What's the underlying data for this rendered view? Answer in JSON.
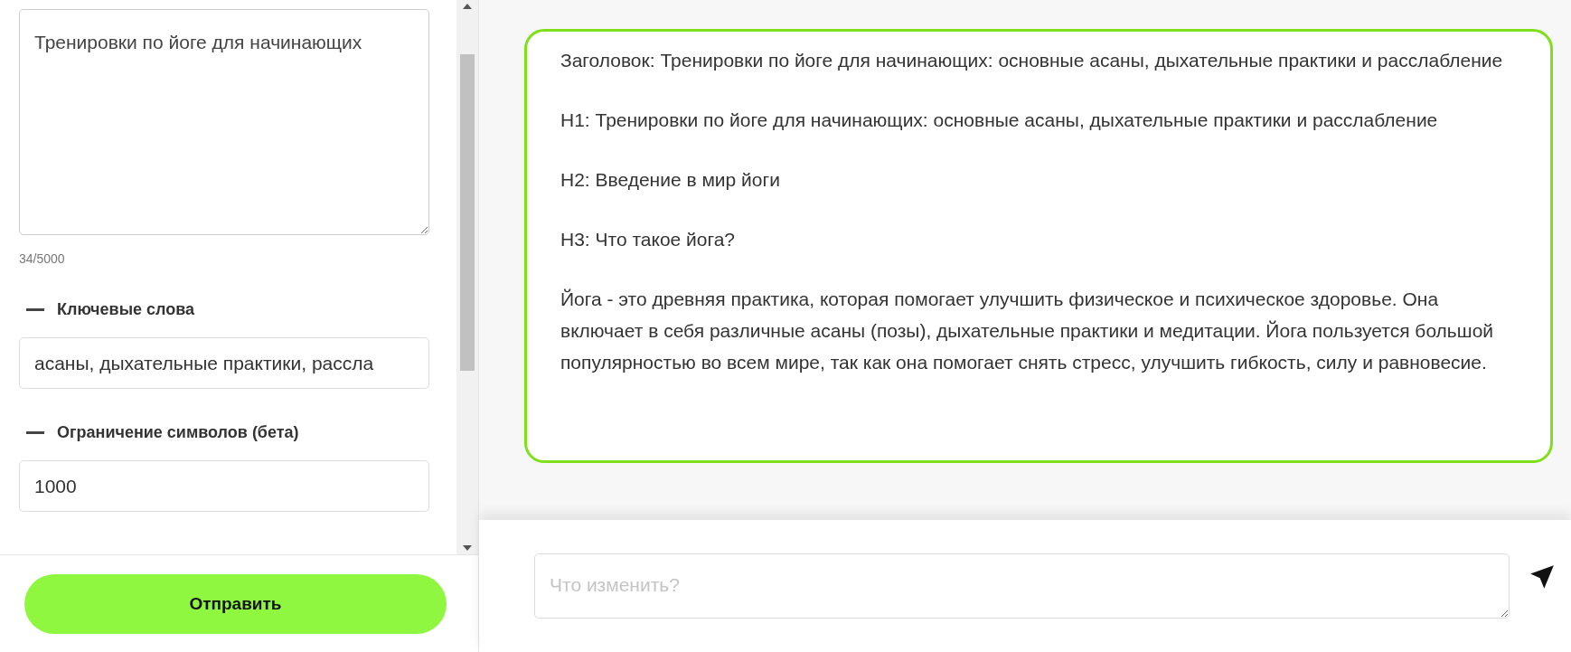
{
  "form": {
    "topic": {
      "value": "Тренировки по йоге для начинающих"
    },
    "counter": "34/5000",
    "fields": [
      {
        "label": "Ключевые слова",
        "value": "асаны, дыхательные практики, рассла"
      },
      {
        "label": "Ограничение символов (бета)",
        "value": "1000"
      }
    ],
    "submit": "Отправить"
  },
  "result": {
    "paragraphs": [
      "Заголовок: Тренировки по йоге для начинающих: основные асаны, дыхательные практики и расслабление",
      "H1: Тренировки по йоге для начинающих: основные асаны, дыхательные практики и расслабление",
      "H2: Введение в мир йоги",
      "H3: Что такое йога?",
      "Йога - это древняя практика, которая помогает улучшить физическое и психическое здоровье. Она включает в себя различные асаны (позы), дыхательные практики и медитации. Йога пользуется большой популярностью во всем мире, так как она помогает снять стресс, улучшить гибкость, силу и равновесие."
    ]
  },
  "chat": {
    "placeholder": "Что изменить?"
  }
}
